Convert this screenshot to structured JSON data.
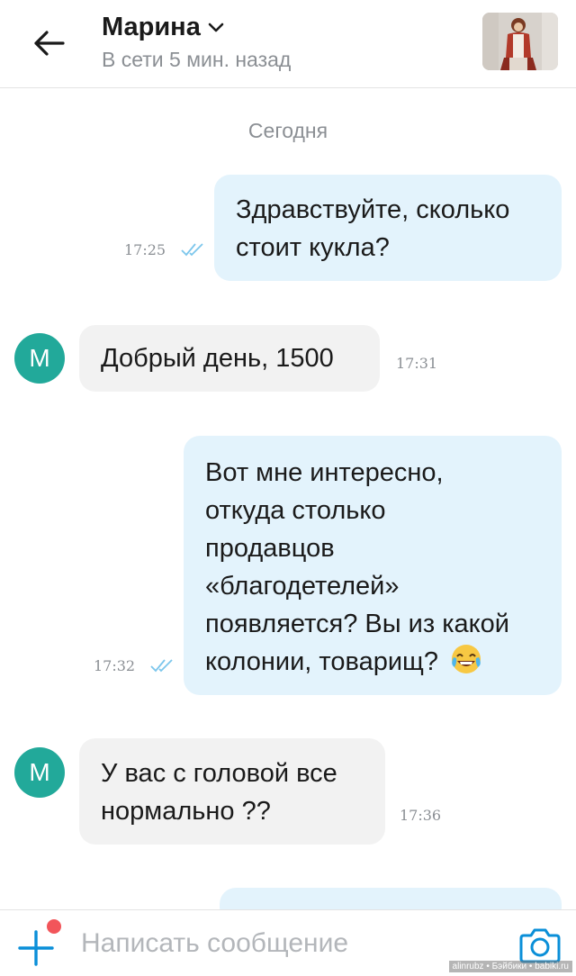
{
  "header": {
    "title": "Марина",
    "status": "В сети 5 мин. назад"
  },
  "chat": {
    "date_separator": "Сегодня",
    "messages": [
      {
        "direction": "out",
        "lines": [
          "Здравствуйте, сколько",
          "стоит кукла?"
        ],
        "time": "17:25",
        "read": true
      },
      {
        "direction": "in",
        "avatar_letter": "М",
        "lines": [
          "Добрый день, 1500"
        ],
        "time": "17:31"
      },
      {
        "direction": "out",
        "lines": [
          "Вот мне интересно,",
          "откуда столько",
          "продавцов",
          "«благодетелей»",
          "появляется? Вы из какой",
          "колонии, товарищ?"
        ],
        "time": "17:32",
        "read": true,
        "emoji": "face-with-tears-of-joy"
      },
      {
        "direction": "in",
        "avatar_letter": "М",
        "lines": [
          "У вас с головой все",
          "нормально ??"
        ],
        "time": "17:36"
      }
    ]
  },
  "input": {
    "placeholder": "Написать сообщение"
  },
  "watermark": "alinrubz • Бэйбики • babiki.ru",
  "colors": {
    "outgoing_bubble": "#e3f3fc",
    "incoming_bubble": "#f2f2f2",
    "accent": "#0a8fd8",
    "avatar": "#22a99a",
    "read_checks": "#7cc6ec",
    "notification_dot": "#f2555a"
  }
}
